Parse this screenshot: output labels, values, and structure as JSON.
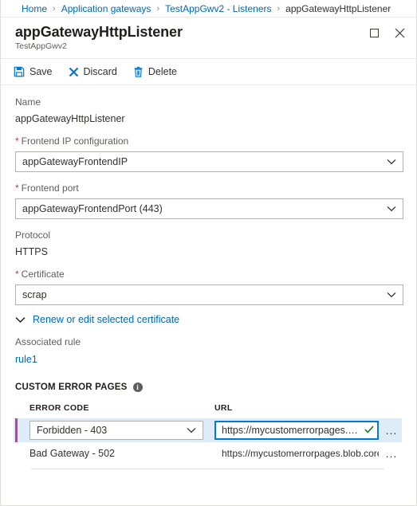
{
  "breadcrumb": {
    "separator": "›",
    "items": [
      {
        "label": "Home",
        "current": false
      },
      {
        "label": "Application gateways",
        "current": false
      },
      {
        "label": "TestAppGwv2 - Listeners",
        "current": false
      },
      {
        "label": "appGatewayHttpListener",
        "current": true
      }
    ]
  },
  "header": {
    "title": "appGatewayHttpListener",
    "subtitle": "TestAppGwv2",
    "maximize_icon": "maximize-icon",
    "close_icon": "close-icon"
  },
  "toolbar": {
    "save_label": "Save",
    "discard_label": "Discard",
    "delete_label": "Delete"
  },
  "form": {
    "name": {
      "label": "Name",
      "value": "appGatewayHttpListener"
    },
    "frontend_ip": {
      "label": "Frontend IP configuration",
      "required": true,
      "value": "appGatewayFrontendIP"
    },
    "frontend_port": {
      "label": "Frontend port",
      "required": true,
      "value": "appGatewayFrontendPort (443)"
    },
    "protocol": {
      "label": "Protocol",
      "value": "HTTPS"
    },
    "certificate": {
      "label": "Certificate",
      "required": true,
      "value": "scrap"
    },
    "renew_link": "Renew or edit selected certificate",
    "associated_rule": {
      "label": "Associated rule",
      "value": "rule1"
    }
  },
  "custom_error_pages": {
    "section_title": "CUSTOM ERROR PAGES",
    "info_glyph": "i",
    "columns": {
      "error_code": "ERROR CODE",
      "url": "URL"
    },
    "rows": [
      {
        "error_code": "Forbidden - 403",
        "url": "https://mycustomerrorpages.blob.core.w",
        "selected": true,
        "validated": true,
        "menu": "..."
      },
      {
        "error_code": "Bad Gateway - 502",
        "url": "https://mycustomerrorpages.blob.core.wind...",
        "selected": false,
        "validated": false,
        "menu": "..."
      }
    ]
  },
  "colors": {
    "accent_blue": "#0078d4",
    "link_blue": "#0067b8",
    "required_red": "#d13438",
    "row_accent_magenta": "#c239b3",
    "selected_row_bg": "#deecf9",
    "valid_green": "#107c10"
  }
}
